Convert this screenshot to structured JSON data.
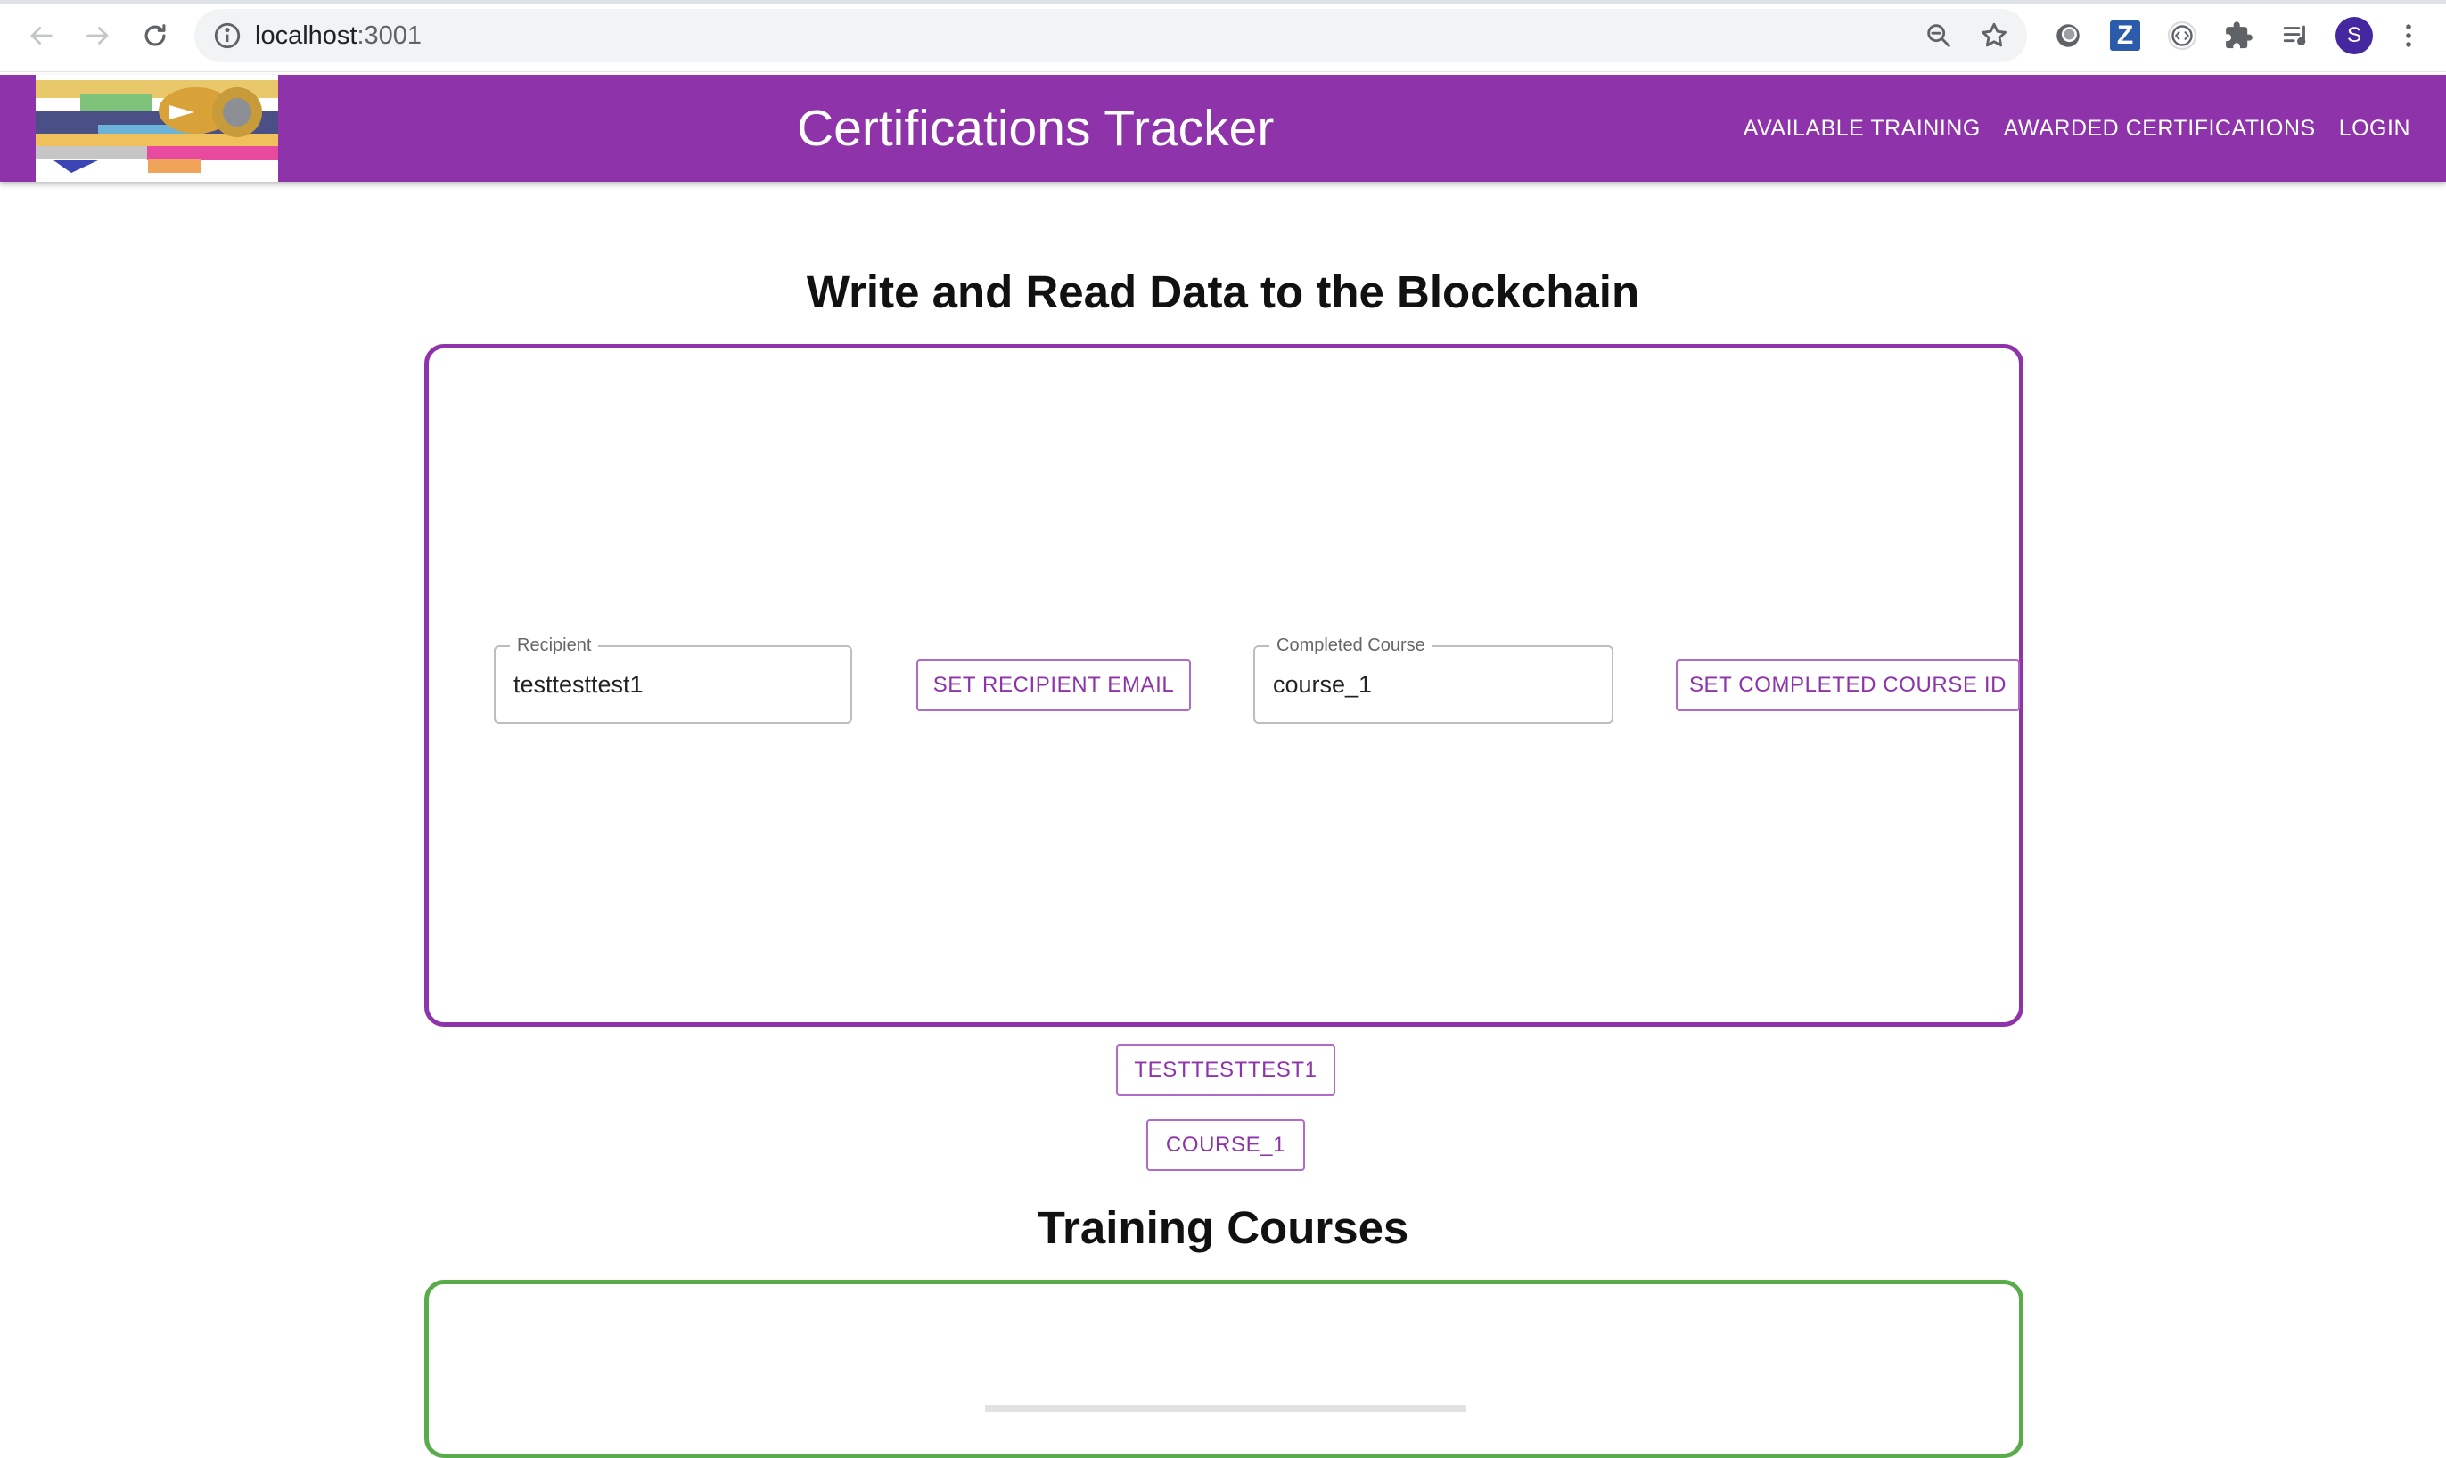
{
  "browser": {
    "url_host": "localhost",
    "url_port": ":3001",
    "profile_initial": "S"
  },
  "header": {
    "title": "Certifications Tracker",
    "nav": [
      "AVAILABLE TRAINING",
      "AWARDED CERTIFICATIONS",
      "LOGIN"
    ],
    "color": "#8e33aa"
  },
  "blockchain_section": {
    "heading": "Write and Read Data to the Blockchain",
    "recipient": {
      "label": "Recipient",
      "value": "testtesttest1"
    },
    "set_recipient_button": "SET RECIPIENT EMAIL",
    "course": {
      "label": "Completed Course",
      "value": "course_1"
    },
    "set_course_button": "SET COMPLETED COURSE ID",
    "read_recipient_button": "TESTTESTTEST1",
    "read_course_button": "COURSE_1",
    "border_color": "#8e33aa"
  },
  "training_section": {
    "heading": "Training Courses",
    "border_color": "#5aab4a"
  }
}
